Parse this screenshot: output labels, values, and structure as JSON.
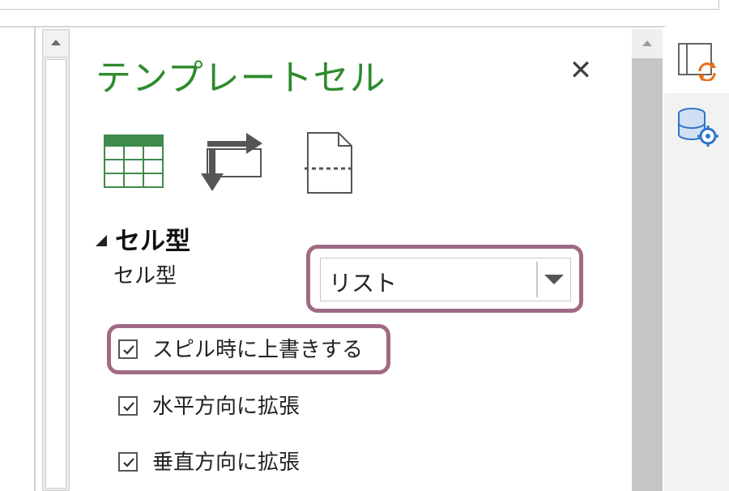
{
  "pane": {
    "title": "テンプレートセル",
    "close_label": "✕"
  },
  "toolbar": {
    "icons": [
      "table-icon",
      "swap-arrows-icon",
      "page-break-icon"
    ]
  },
  "section": {
    "header": "セル型",
    "field_label": "セル型",
    "select_value": "リスト"
  },
  "checkboxes": [
    {
      "label": "スピル時に上書きする",
      "checked": true
    },
    {
      "label": "水平方向に拡張",
      "checked": true
    },
    {
      "label": "垂直方向に拡張",
      "checked": true
    }
  ],
  "side_tabs": {
    "icons": [
      "template-refresh-icon",
      "database-settings-icon"
    ]
  },
  "colors": {
    "title": "#2e8b2e",
    "highlight": "#a06a83",
    "tab_accent": "#e8701a",
    "tab_blue": "#2e75c9"
  }
}
